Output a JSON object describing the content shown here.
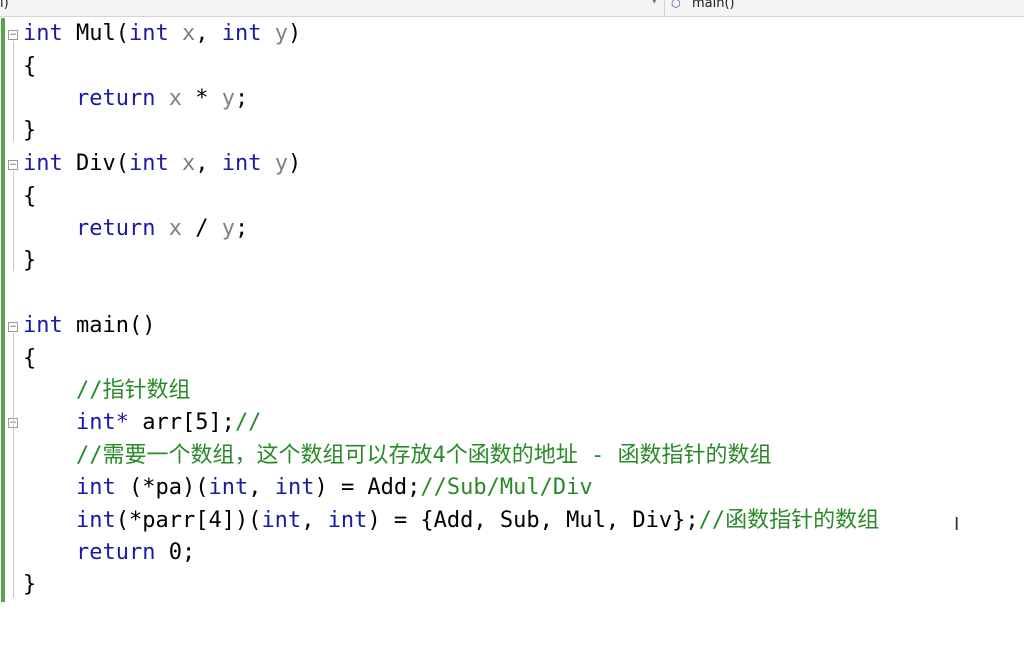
{
  "scope_bar": {
    "left_scope": "l)",
    "dropdown_arrow": "▾",
    "function_icon": "cube-icon",
    "function_name": "main()"
  },
  "code": {
    "mul": {
      "kw_int": "int",
      "name": "Mul(",
      "kw_int2": "int",
      "px": "x",
      "comma": ", ",
      "kw_int3": "int",
      "py": "y",
      "close": ")",
      "open_brace": "{",
      "kw_return": "return",
      "expr_x": "x",
      "op": " * ",
      "expr_y": "y",
      "semi": ";",
      "close_brace": "}"
    },
    "div": {
      "kw_int": "int",
      "name": "Div(",
      "kw_int2": "int",
      "px": "x",
      "comma": ", ",
      "kw_int3": "int",
      "py": "y",
      "close": ")",
      "open_brace": "{",
      "kw_return": "return",
      "expr_x": "x",
      "op": " / ",
      "expr_y": "y",
      "semi": ";",
      "close_brace": "}"
    },
    "main": {
      "kw_int": "int",
      "name": "main()",
      "open_brace": "{",
      "comment1": "//指针数组",
      "arr_type": "int*",
      "arr_decl": " arr[5];",
      "arr_comment": "//",
      "comment2": "//需要一个数组，这个数组可以存放4个函数的地址 - 函数指针的数组",
      "pa_int": "int",
      "pa_decl": " (*pa)(",
      "pa_int2": "int",
      "pa_sep": ", ",
      "pa_int3": "int",
      "pa_assign": ") = Add;",
      "pa_comment": "//Sub/Mul/Div",
      "parr_int": "int",
      "parr_decl": "(*parr[4])(",
      "parr_int2": "int",
      "parr_sep": ", ",
      "parr_int3": "int",
      "parr_assign": ") = {Add, Sub, Mul, Div};",
      "parr_comment": "//函数指针的数组",
      "ret_kw": "return",
      "ret_val": " 0;",
      "close_brace": "}"
    }
  },
  "cursor": "I"
}
